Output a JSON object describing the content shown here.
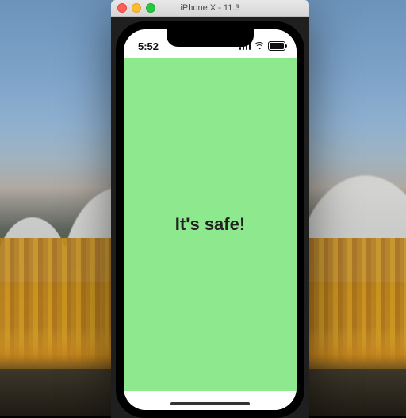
{
  "simulator": {
    "window_title": "iPhone X - 11.3"
  },
  "statusbar": {
    "time": "5:52"
  },
  "app": {
    "message": "It's safe!",
    "background_color": "#8ee88e"
  }
}
